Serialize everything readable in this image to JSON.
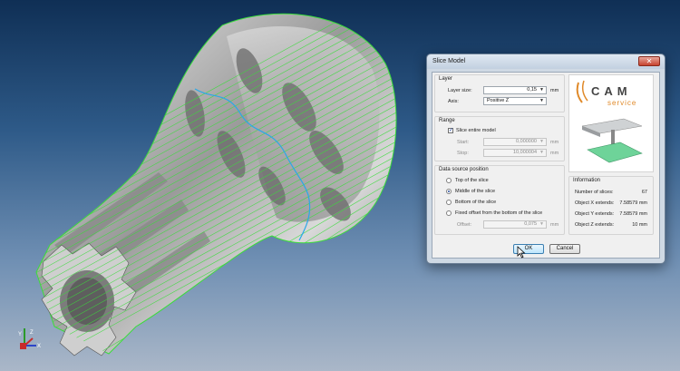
{
  "dialog": {
    "title": "Slice Model",
    "close_label": "✕",
    "layer": {
      "group_title": "Layer",
      "layer_size_label": "Layer size:",
      "layer_size_value": "0,15",
      "layer_size_unit": "mm",
      "axis_label": "Axis:",
      "axis_value": "Positive Z"
    },
    "range": {
      "group_title": "Range",
      "slice_entire_label": "Slice entire model",
      "slice_entire_checked": true,
      "start_label": "Start:",
      "start_value": "0,000000",
      "start_unit": "mm",
      "stop_label": "Stop:",
      "stop_value": "10,000004",
      "stop_unit": "mm"
    },
    "data_source": {
      "group_title": "Data source position",
      "options": [
        {
          "label": "Top of the slice",
          "selected": false
        },
        {
          "label": "Middle of the slice",
          "selected": true
        },
        {
          "label": "Bottom of the slice",
          "selected": false
        },
        {
          "label": "Fixed offset from the bottom of the slice",
          "selected": false
        }
      ],
      "offset_label": "Offset:",
      "offset_value": "0,075",
      "offset_unit": "mm"
    },
    "logo": {
      "brand": "CAM",
      "sub": "service"
    },
    "information": {
      "group_title": "Information",
      "rows": [
        {
          "key": "Number of slices:",
          "value": "67"
        },
        {
          "key": "Object X extends:",
          "value": "7.58579 mm"
        },
        {
          "key": "Object Y extends:",
          "value": "7.58579 mm"
        },
        {
          "key": "Object Z extends:",
          "value": "10 mm"
        }
      ]
    },
    "ok_label": "OK",
    "cancel_label": "Cancel"
  },
  "axis_triad": {
    "x": "X",
    "y": "Y",
    "z": "Z"
  },
  "colors": {
    "slice_line": "#3cdc3c",
    "highlight_line": "#2aa8e8",
    "background_top": "#0f2f55",
    "background_bottom": "#aab7c8"
  }
}
